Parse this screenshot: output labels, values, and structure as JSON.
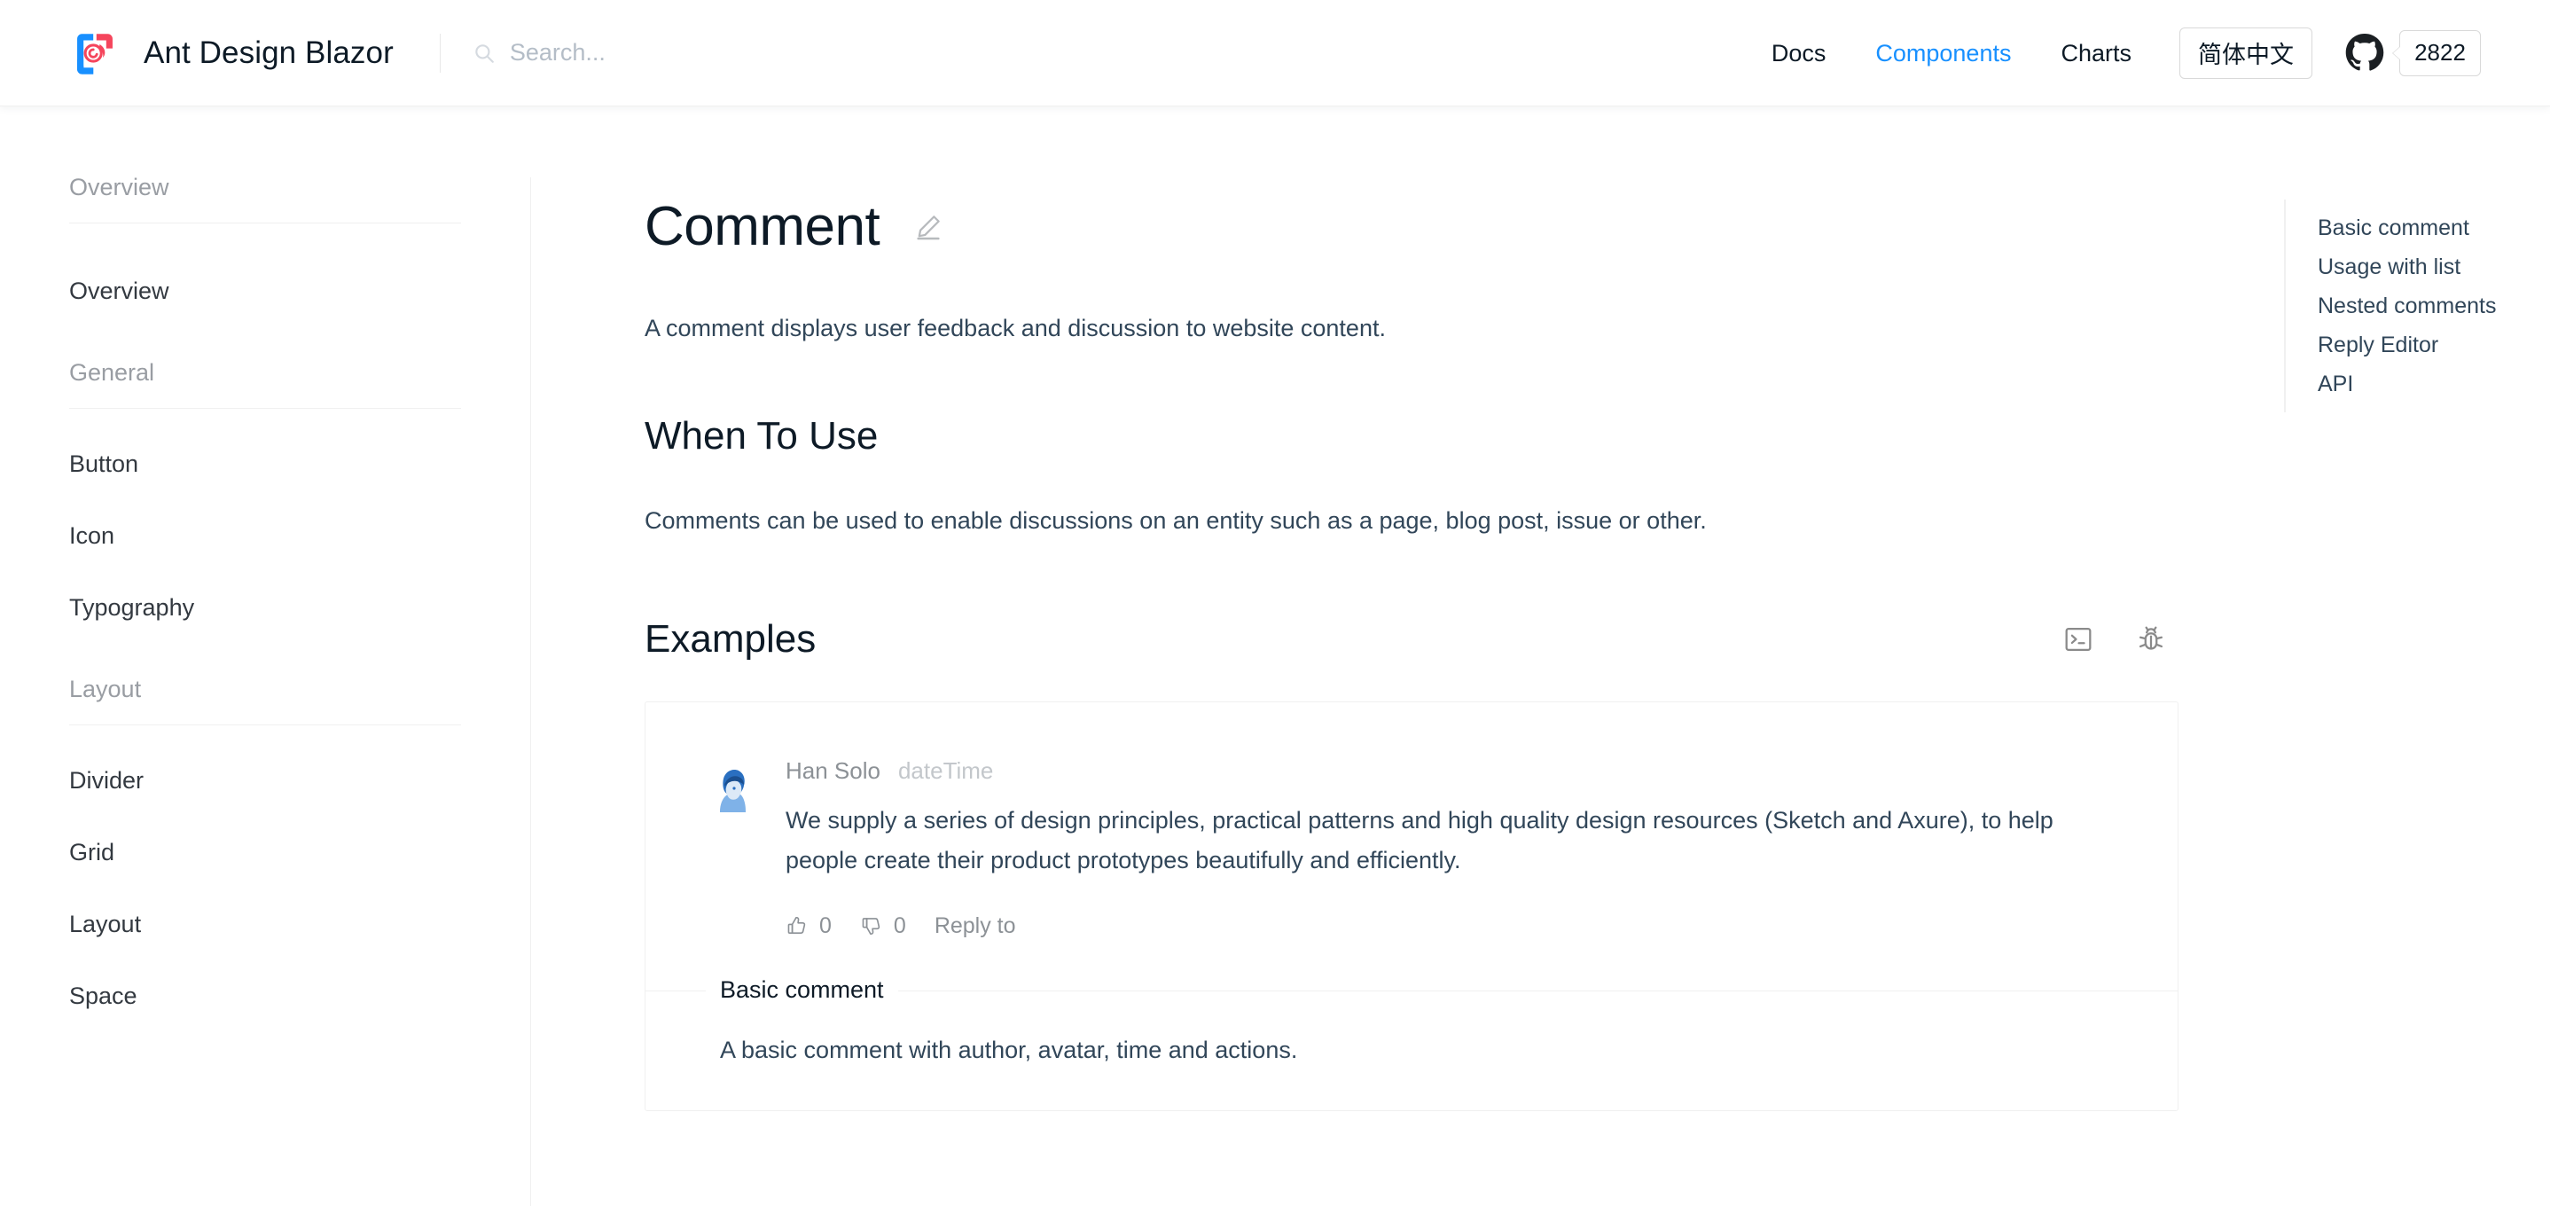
{
  "header": {
    "brand_title": "Ant Design Blazor",
    "logo_name": "ant-design-blazor-logo",
    "search": {
      "placeholder": "Search...",
      "value": ""
    },
    "nav": [
      {
        "label": "Docs",
        "active": false
      },
      {
        "label": "Components",
        "active": true
      },
      {
        "label": "Charts",
        "active": false
      }
    ],
    "lang_button": "简体中文",
    "github_stars": "2822"
  },
  "sidebar": {
    "groups": [
      {
        "title": "Overview",
        "items": [
          {
            "label": "Overview"
          }
        ]
      },
      {
        "title": "General",
        "items": [
          {
            "label": "Button"
          },
          {
            "label": "Icon"
          },
          {
            "label": "Typography"
          }
        ]
      },
      {
        "title": "Layout",
        "items": [
          {
            "label": "Divider"
          },
          {
            "label": "Grid"
          },
          {
            "label": "Layout"
          },
          {
            "label": "Space"
          }
        ]
      }
    ]
  },
  "main": {
    "page_title": "Comment",
    "lead": "A comment displays user feedback and discussion to website content.",
    "when_to_use_heading": "When To Use",
    "when_to_use_text": "Comments can be used to enable discussions on an entity such as a page, blog post, issue or other.",
    "examples_heading": "Examples",
    "examples_actions": [
      {
        "name": "code-icon",
        "title": "Show all code"
      },
      {
        "name": "bug-icon",
        "title": "Report bug"
      }
    ],
    "demo": {
      "comment": {
        "author": "Han Solo",
        "datetime": "dateTime",
        "text": "We supply a series of design principles, practical patterns and high quality design resources (Sketch and Axure), to help people create their product prototypes beautifully and efficiently.",
        "like_count": "0",
        "dislike_count": "0",
        "reply_label": "Reply to"
      },
      "legend": "Basic comment",
      "description": "A basic comment with author, avatar, time and actions."
    }
  },
  "toc": {
    "items": [
      {
        "label": "Basic comment"
      },
      {
        "label": "Usage with list"
      },
      {
        "label": "Nested comments"
      },
      {
        "label": "Reply Editor"
      },
      {
        "label": "API"
      }
    ]
  },
  "colors": {
    "accent": "#1890ff",
    "text": "#314659",
    "heading": "#0d1a26",
    "muted": "#999da3",
    "border": "#f0f0f0",
    "logo_blue": "#1890ff",
    "logo_red": "#f5455c"
  }
}
